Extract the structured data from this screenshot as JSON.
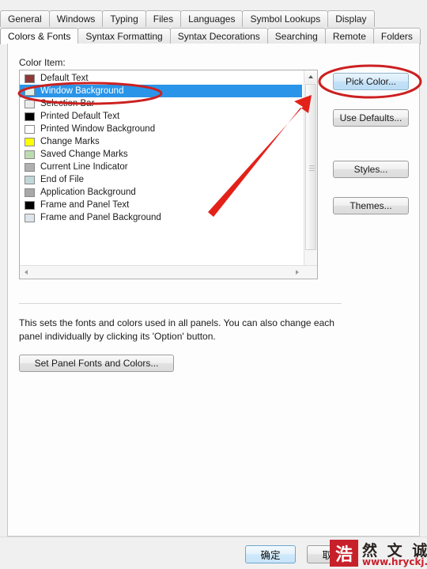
{
  "tabs": {
    "row1": [
      {
        "label": "General",
        "selected": false
      },
      {
        "label": "Windows",
        "selected": false
      },
      {
        "label": "Typing",
        "selected": false
      },
      {
        "label": "Files",
        "selected": false
      },
      {
        "label": "Languages",
        "selected": false
      },
      {
        "label": "Symbol Lookups",
        "selected": false
      },
      {
        "label": "Display",
        "selected": false
      }
    ],
    "row2": [
      {
        "label": "Colors & Fonts",
        "selected": true
      },
      {
        "label": "Syntax Formatting",
        "selected": false
      },
      {
        "label": "Syntax Decorations",
        "selected": false
      },
      {
        "label": "Searching",
        "selected": false
      },
      {
        "label": "Remote",
        "selected": false
      },
      {
        "label": "Folders",
        "selected": false
      }
    ]
  },
  "list": {
    "label": "Color Item:",
    "items": [
      {
        "label": "Default Text",
        "swatch": "#8c3a36",
        "selected": false
      },
      {
        "label": "Window Background",
        "swatch": "#dff0ea",
        "selected": true
      },
      {
        "label": "Selection Bar",
        "swatch": "#ebebeb",
        "selected": false
      },
      {
        "label": "Printed Default Text",
        "swatch": "#000000",
        "selected": false
      },
      {
        "label": "Printed Window Background",
        "swatch": "#ffffff",
        "selected": false
      },
      {
        "label": "Change Marks",
        "swatch": "#ffff00",
        "selected": false
      },
      {
        "label": "Saved Change Marks",
        "swatch": "#bcdcae",
        "selected": false
      },
      {
        "label": "Current Line Indicator",
        "swatch": "#b0b0b0",
        "selected": false
      },
      {
        "label": "End of File",
        "swatch": "#c2d8d8",
        "selected": false
      },
      {
        "label": "Application Background",
        "swatch": "#a8a8a8",
        "selected": false
      },
      {
        "label": "Frame and Panel Text",
        "swatch": "#000000",
        "selected": false
      },
      {
        "label": "Frame and Panel Background",
        "swatch": "#dde4ea",
        "selected": false
      }
    ]
  },
  "buttons": {
    "pick_color": "Pick Color...",
    "use_defaults": "Use Defaults...",
    "styles": "Styles...",
    "themes": "Themes...",
    "set_panel": "Set Panel Fonts and Colors..."
  },
  "description": "This sets the fonts and colors used in all panels. You can also change each panel individually by clicking its 'Option' button.",
  "footer": {
    "ok": "确定",
    "cancel": "取消"
  },
  "watermark": {
    "seal": "浩",
    "chars": "然 文 诚",
    "url": "www.hryckj.cn"
  },
  "annotations": {
    "accent_color": "#cc2020",
    "ellipse_list_item": "Window Background",
    "ellipse_button": "Pick Color...",
    "arrow": "points to scrollbar / selected row"
  }
}
